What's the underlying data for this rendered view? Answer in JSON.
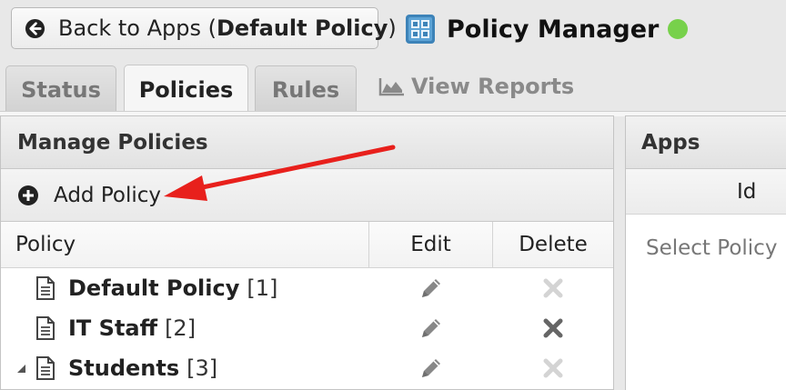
{
  "header": {
    "back_prefix": "Back to Apps (",
    "back_policy": "Default Policy",
    "back_suffix": ")",
    "app_title": "Policy Manager",
    "status_color": "#77d14b"
  },
  "tabs": [
    {
      "label": "Status",
      "active": false
    },
    {
      "label": "Policies",
      "active": true
    },
    {
      "label": "Rules",
      "active": false
    }
  ],
  "reports_tab": {
    "label": "View Reports",
    "icon": "area-chart-icon"
  },
  "policies_panel": {
    "title": "Manage Policies",
    "add_label": "Add Policy",
    "columns": {
      "policy": "Policy",
      "edit": "Edit",
      "delete": "Delete"
    },
    "rows": [
      {
        "name": "Default Policy",
        "id": "[1]",
        "delete_enabled": false,
        "expandable": false
      },
      {
        "name": "IT Staff",
        "id": "[2]",
        "delete_enabled": true,
        "expandable": false
      },
      {
        "name": "Students",
        "id": "[3]",
        "delete_enabled": false,
        "expandable": true
      }
    ]
  },
  "apps_panel": {
    "title": "Apps",
    "column_id": "Id",
    "empty_text": "Select Policy"
  },
  "annotation": {
    "arrow_color": "#e8201c"
  }
}
